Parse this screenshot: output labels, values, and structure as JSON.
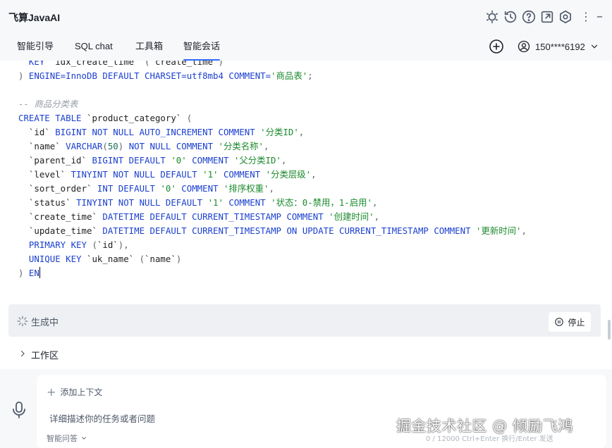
{
  "app": {
    "title": "飞算JavaAI",
    "header_icons": [
      "theme-toggle-icon",
      "history-icon",
      "help-icon",
      "open-external-icon",
      "settings-icon",
      "more-icon",
      "close-icon"
    ]
  },
  "tabs": [
    {
      "label": "智能引导"
    },
    {
      "label": "SQL chat"
    },
    {
      "label": "工具箱"
    },
    {
      "label": "智能会话",
      "active": true
    }
  ],
  "account": {
    "name": "150****6192"
  },
  "code": {
    "lines": [
      [
        [
          "  KEY ",
          "kw"
        ],
        [
          "`idx_create_time`",
          "id"
        ],
        [
          " (",
          "pun"
        ],
        [
          "`create_time`",
          "id"
        ],
        [
          ")",
          "pun"
        ]
      ],
      [
        [
          ") ",
          "pun"
        ],
        [
          "ENGINE=InnoDB DEFAULT CHARSET=utf8mb4 COMMENT=",
          "kw"
        ],
        [
          "'商品表'",
          "str"
        ],
        [
          ";",
          "pun"
        ]
      ],
      [
        [
          "",
          "id"
        ]
      ],
      [
        [
          "-- 商品分类表",
          "com"
        ]
      ],
      [
        [
          "CREATE TABLE ",
          "kw"
        ],
        [
          "`product_category`",
          "id"
        ],
        [
          " (",
          "pun"
        ]
      ],
      [
        [
          "  ",
          "id"
        ],
        [
          "`id`",
          "id"
        ],
        [
          " BIGINT NOT NULL AUTO_INCREMENT COMMENT ",
          "kw"
        ],
        [
          "'分类ID'",
          "str"
        ],
        [
          ",",
          "pun"
        ]
      ],
      [
        [
          "  ",
          "id"
        ],
        [
          "`name`",
          "id"
        ],
        [
          " VARCHAR",
          "kw"
        ],
        [
          "(",
          "pun"
        ],
        [
          "50",
          "num"
        ],
        [
          ") ",
          "pun"
        ],
        [
          "NOT NULL COMMENT ",
          "kw"
        ],
        [
          "'分类名称'",
          "str"
        ],
        [
          ",",
          "pun"
        ]
      ],
      [
        [
          "  ",
          "id"
        ],
        [
          "`parent_id`",
          "id"
        ],
        [
          " BIGINT DEFAULT ",
          "kw"
        ],
        [
          "'0'",
          "str"
        ],
        [
          " COMMENT ",
          "kw"
        ],
        [
          "'父分类ID'",
          "str"
        ],
        [
          ",",
          "pun"
        ]
      ],
      [
        [
          "  ",
          "id"
        ],
        [
          "`level`",
          "id"
        ],
        [
          " TINYINT NOT NULL DEFAULT ",
          "kw"
        ],
        [
          "'1'",
          "str"
        ],
        [
          " COMMENT ",
          "kw"
        ],
        [
          "'分类层级'",
          "str"
        ],
        [
          ",",
          "pun"
        ]
      ],
      [
        [
          "  ",
          "id"
        ],
        [
          "`sort_order`",
          "id"
        ],
        [
          " INT DEFAULT ",
          "kw"
        ],
        [
          "'0'",
          "str"
        ],
        [
          " COMMENT ",
          "kw"
        ],
        [
          "'排序权重'",
          "str"
        ],
        [
          ",",
          "pun"
        ]
      ],
      [
        [
          "  ",
          "id"
        ],
        [
          "`status`",
          "id"
        ],
        [
          " TINYINT NOT NULL DEFAULT ",
          "kw"
        ],
        [
          "'1'",
          "str"
        ],
        [
          " COMMENT ",
          "kw"
        ],
        [
          "'状态：0-禁用，1-启用'",
          "str"
        ],
        [
          ",",
          "pun"
        ]
      ],
      [
        [
          "  ",
          "id"
        ],
        [
          "`create_time`",
          "id"
        ],
        [
          " DATETIME DEFAULT CURRENT_TIMESTAMP COMMENT ",
          "kw"
        ],
        [
          "'创建时间'",
          "str"
        ],
        [
          ",",
          "pun"
        ]
      ],
      [
        [
          "  ",
          "id"
        ],
        [
          "`update_time`",
          "id"
        ],
        [
          " DATETIME DEFAULT CURRENT_TIMESTAMP ON UPDATE CURRENT_TIMESTAMP COMMENT ",
          "kw"
        ],
        [
          "'更新时间'",
          "str"
        ],
        [
          ",",
          "pun"
        ]
      ],
      [
        [
          "  PRIMARY KEY ",
          "kw"
        ],
        [
          "(",
          "pun"
        ],
        [
          "`id`",
          "id"
        ],
        [
          "),",
          "pun"
        ]
      ],
      [
        [
          "  UNIQUE KEY ",
          "kw"
        ],
        [
          "`uk_name`",
          "id"
        ],
        [
          " (",
          "pun"
        ],
        [
          "`name`",
          "id"
        ],
        [
          ")",
          "pun"
        ]
      ],
      [
        [
          ") ",
          "pun"
        ],
        [
          "EN",
          "kw"
        ]
      ]
    ]
  },
  "generating": {
    "label": "生成中",
    "stop_label": "停止"
  },
  "workspace": {
    "label": "工作区"
  },
  "input": {
    "add_context_label": "添加上下文",
    "placeholder": "详细描述你的任务或者问题",
    "mode_label": "智能问答",
    "hint": "0 / 12000  Ctrl+Enter 换行/Enter 发送"
  },
  "watermark": "掘金技术社区 @ 倾励飞鸿",
  "colors": {
    "accent": "#2f6bff",
    "keyword": "#1a3fcf",
    "string": "#1b8a2d",
    "comment": "#9aa0a6"
  }
}
